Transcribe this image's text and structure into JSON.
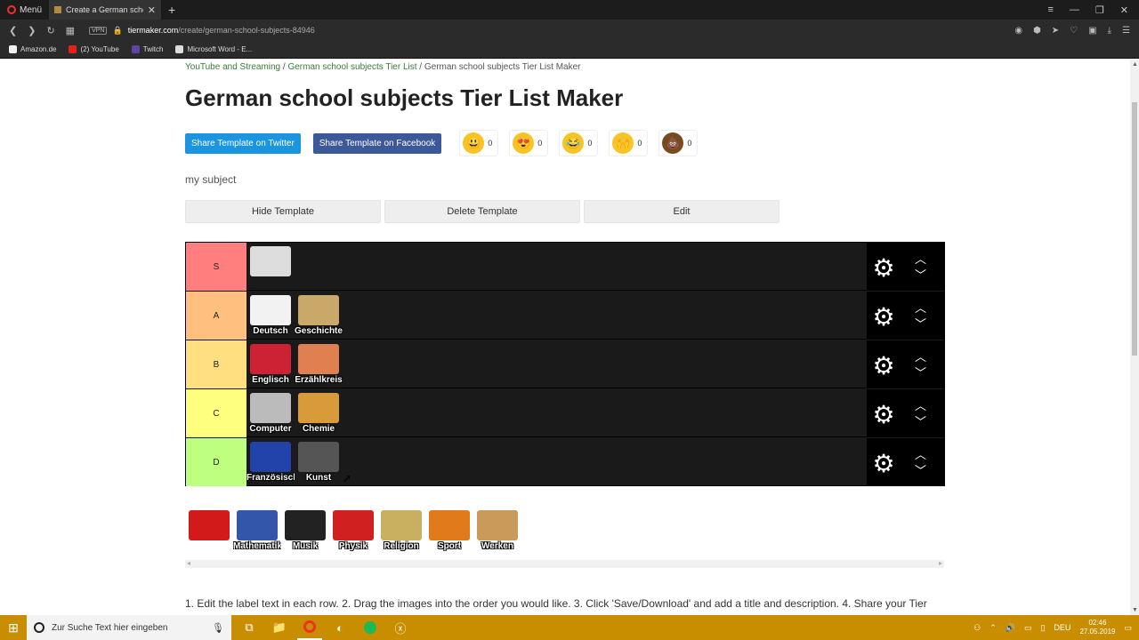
{
  "browser": {
    "menu_label": "Menü",
    "tab_title": "Create a German school su",
    "url_domain": "tiermaker.com",
    "url_path": "/create/german-school-subjects-84946",
    "vpn_label": "VPN",
    "bookmarks": [
      {
        "label": "Amazon.de",
        "color": "#f0f0f0"
      },
      {
        "label": "(2) YouTube",
        "color": "#e62117"
      },
      {
        "label": "Twitch",
        "color": "#6441a4"
      },
      {
        "label": "Microsoft Word - E...",
        "color": "#ddd"
      }
    ]
  },
  "breadcrumb": {
    "part1": "YouTube and Streaming",
    "sep1": " / ",
    "part2": "German school subjects Tier List",
    "sep2": " / ",
    "current": "German school subjects Tier List Maker"
  },
  "title": "German school subjects Tier List Maker",
  "share": {
    "twitter_label": "Share Template on Twitter",
    "facebook_label": "Share Template on Facebook"
  },
  "reactions": [
    {
      "emoji": "😃",
      "count": "0",
      "bg": "#f7c325"
    },
    {
      "emoji": "😍",
      "count": "0",
      "bg": "#f7c325"
    },
    {
      "emoji": "😂",
      "count": "0",
      "bg": "#f7c325"
    },
    {
      "emoji": "🙌",
      "count": "0",
      "bg": "#f7c325"
    },
    {
      "emoji": "💩",
      "count": "0",
      "bg": "#7a4a1f"
    }
  ],
  "description": "my subject",
  "actions": {
    "hide": "Hide Template",
    "delete": "Delete Template",
    "edit": "Edit"
  },
  "tiers": [
    {
      "label": "S",
      "color": "#ff7f7f",
      "items": [
        {
          "caption": "",
          "color": "#dddddd"
        }
      ]
    },
    {
      "label": "A",
      "color": "#ffbf7f",
      "items": [
        {
          "caption": "Deutsch",
          "color": "#f2f2f2"
        },
        {
          "caption": "Geschichte",
          "color": "#c9a86a"
        }
      ]
    },
    {
      "label": "B",
      "color": "#ffdf7f",
      "items": [
        {
          "caption": "Englisch",
          "color": "#cc2233"
        },
        {
          "caption": "Erzählkreis",
          "color": "#e08050"
        }
      ]
    },
    {
      "label": "C",
      "color": "#ffff7f",
      "items": [
        {
          "caption": "Computer",
          "color": "#bbbbbb"
        },
        {
          "caption": "Chemie",
          "color": "#d99a3a"
        }
      ]
    },
    {
      "label": "D",
      "color": "#bfff7f",
      "items": [
        {
          "caption": "Französisch",
          "color": "#2244aa"
        },
        {
          "caption": "Kunst",
          "color": "#555555"
        }
      ]
    }
  ],
  "pool": [
    {
      "caption": "",
      "color": "#d31a1a"
    },
    {
      "caption": "Mathematik",
      "color": "#3355aa"
    },
    {
      "caption": "Musik",
      "color": "#222222"
    },
    {
      "caption": "Physik",
      "color": "#d02020"
    },
    {
      "caption": "Religion",
      "color": "#c8b060"
    },
    {
      "caption": "Sport",
      "color": "#e07a1a"
    },
    {
      "caption": "Werken",
      "color": "#c99a5a"
    }
  ],
  "instructions": "1. Edit the label text in each row. 2. Drag the images into the order you would like. 3. Click 'Save/Download' and add a title and description. 4. Share your Tier",
  "taskbar": {
    "search_placeholder": "Zur Suche Text hier eingeben",
    "lang": "DEU",
    "time": "02:46",
    "date": "27.05.2019"
  }
}
